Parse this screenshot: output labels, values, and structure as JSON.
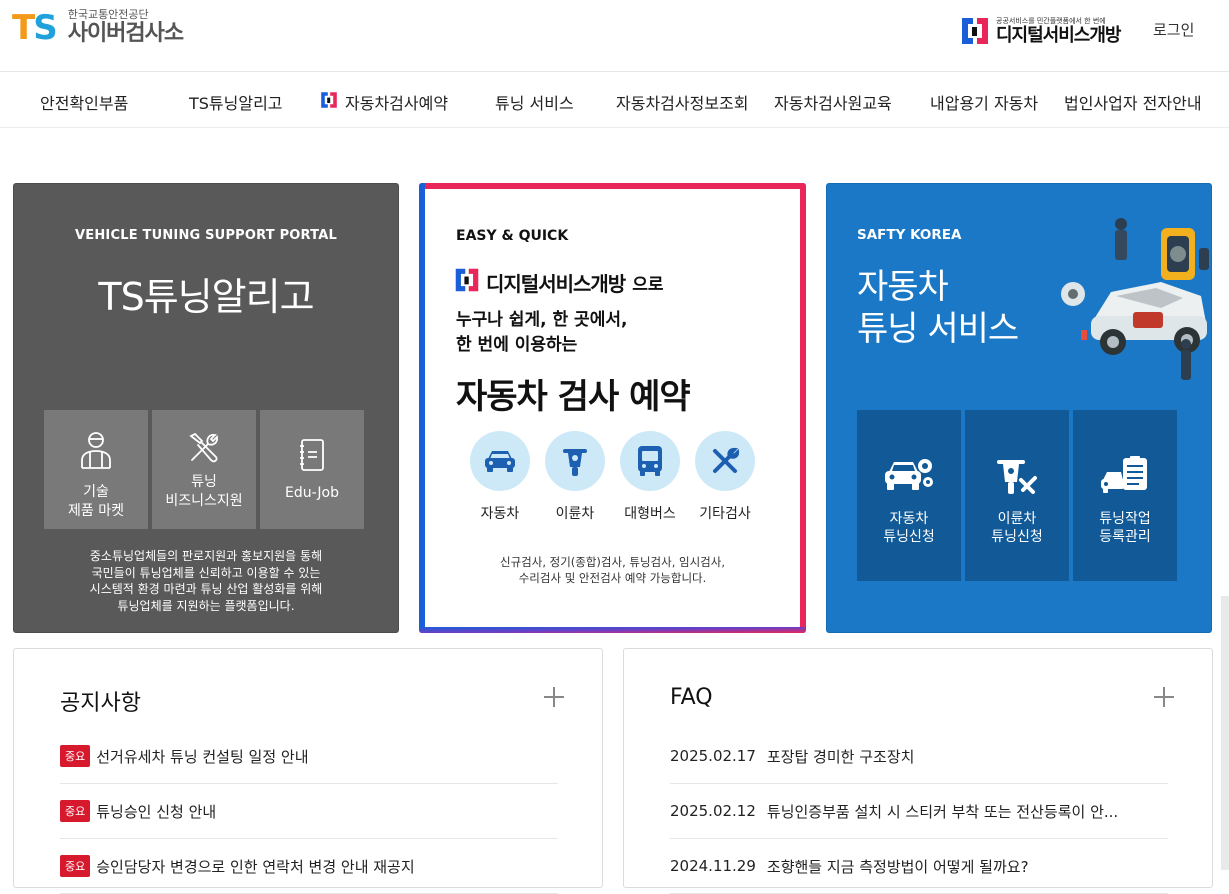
{
  "header": {
    "logo_letters_t": "T",
    "logo_letters_s": "S",
    "logo_sub": "한국교통안전공단",
    "logo_main": "사이버검사소",
    "partner_sub": "공공서비스를 민간플랫폼에서 한 번에",
    "partner_main": "디지털서비스개방",
    "login": "로그인"
  },
  "nav": {
    "items": [
      {
        "label": "안전확인부품"
      },
      {
        "label": "TS튜닝알리고"
      },
      {
        "label": "자동차검사예약"
      },
      {
        "label": "튜닝 서비스"
      },
      {
        "label": "자동차검사정보조회"
      },
      {
        "label": "자동차검사원교육"
      },
      {
        "label": "내압용기 자동차"
      },
      {
        "label": "법인사업자 전자안내"
      }
    ]
  },
  "card_left": {
    "eyebrow": "VEHICLE TUNING SUPPORT PORTAL",
    "title": "TS튜닝알리고",
    "tiles": [
      {
        "line1": "기술",
        "line2": "제품 마켓"
      },
      {
        "line1": "튜닝",
        "line2": "비즈니스지원"
      },
      {
        "line1": "Edu-Job",
        "line2": ""
      }
    ],
    "desc": [
      "중소튜닝업체들의 판로지원과 홍보지원을 통해",
      "국민들이 튜닝업체를 신뢰하고 이용할 수 있는",
      "시스템적 환경 마련과 튜닝 산업 활성화를 위해",
      "튜닝업체를 지원하는 플랫폼입니다."
    ]
  },
  "card_mid": {
    "eyebrow": "EASY & QUICK",
    "brand": "디지털서비스개방",
    "brand_suffix": "으로",
    "line1": "누구나 쉽게, 한 곳에서,",
    "line2": "한 번에 이용하는",
    "title": "자동차 검사 예약",
    "services": [
      {
        "label": "자동차",
        "icon": "car-icon"
      },
      {
        "label": "이륜차",
        "icon": "motorcycle-icon"
      },
      {
        "label": "대형버스",
        "icon": "bus-icon"
      },
      {
        "label": "기타검사",
        "icon": "tools-icon"
      }
    ],
    "desc": [
      "신규검사, 정기(종합)검사, 튜닝검사, 임시검사,",
      "수리검사 및 안전검사 예약 가능합니다."
    ],
    "colors": {
      "frame_top": "#e8265a",
      "frame_left": "#1a5fd8",
      "circle": "#cde9f7",
      "icon": "#1d5fb0"
    }
  },
  "card_right": {
    "eyebrow": "SAFTY KOREA",
    "title_line1": "자동차",
    "title_line2": "튜닝 서비스",
    "tiles": [
      {
        "line1": "자동차",
        "line2": "튜닝신청"
      },
      {
        "line1": "이륜차",
        "line2": "튜닝신청"
      },
      {
        "line1": "튜닝작업",
        "line2": "등록관리"
      }
    ]
  },
  "notice": {
    "title": "공지사항",
    "badge": "중요",
    "items": [
      {
        "text": "선거유세차 튜닝 컨설팅 일정 안내"
      },
      {
        "text": "튜닝승인 신청 안내"
      },
      {
        "text": "승인담당자 변경으로 인한 연락처 변경 안내 재공지"
      }
    ]
  },
  "faq": {
    "title": "FAQ",
    "items": [
      {
        "date": "2025.02.17",
        "text": "포장탑 경미한 구조장치"
      },
      {
        "date": "2025.02.12",
        "text": "튜닝인증부품 설치 시 스티커 부착 또는 전산등록이 안..."
      },
      {
        "date": "2024.11.29",
        "text": "조향핸들 지금 측정방법이 어떻게 될까요?"
      }
    ]
  }
}
